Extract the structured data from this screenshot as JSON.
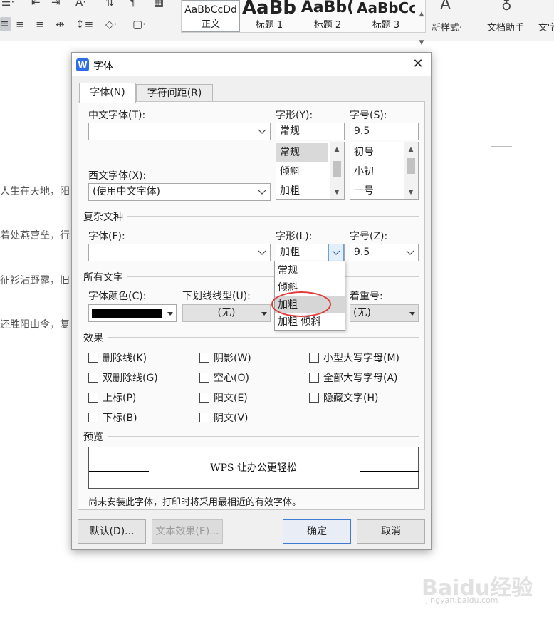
{
  "ribbon": {
    "styles": [
      {
        "preview": "AaBbCcDd",
        "name": "正文"
      },
      {
        "preview": "AaBb",
        "name": "标题 1"
      },
      {
        "preview": "AaBb(",
        "name": "标题 2"
      },
      {
        "preview": "AaBbCc",
        "name": "标题 3"
      }
    ],
    "new_style": "新样式·",
    "doc_assistant": "文档助手",
    "text_tools": "文字"
  },
  "document": {
    "lines": [
      "人生在天地，阳",
      "着处燕营垒，行",
      "征衫沾野露，旧",
      "还胜阳山令，复"
    ]
  },
  "dialog": {
    "app_icon": "W",
    "title": "字体",
    "close": "✕",
    "tabs": [
      "字体(N)",
      "字符间距(R)"
    ],
    "chinese_font_label": "中文字体(T):",
    "chinese_font_value": "",
    "style_label": "字形(Y):",
    "style_value": "常规",
    "style_list": [
      "常规",
      "倾斜",
      "加粗"
    ],
    "size_label": "字号(S):",
    "size_value": "9.5",
    "size_list": [
      "初号",
      "小初",
      "一号"
    ],
    "western_font_label": "西文字体(X):",
    "western_font_value": "(使用中文字体)",
    "complex_section": "复杂文种",
    "complex_font_label": "字体(F):",
    "complex_font_value": "",
    "complex_style_label": "字形(L):",
    "complex_style_value": "加粗",
    "complex_size_label": "字号(Z):",
    "complex_size_value": "9.5",
    "all_text_section": "所有文字",
    "font_color_label": "字体颜色(C):",
    "font_color_value": "#000000",
    "underline_label": "下划线线型(U):",
    "underline_value": "(无)",
    "emphasis_label": "着重号:",
    "emphasis_value": "(无)",
    "effects_section": "效果",
    "effects": [
      [
        "删除线(K)",
        "阴影(W)",
        "小型大写字母(M)"
      ],
      [
        "双删除线(G)",
        "空心(O)",
        "全部大写字母(A)"
      ],
      [
        "上标(P)",
        "阳文(E)",
        "隐藏文字(H)"
      ],
      [
        "下标(B)",
        "阴文(V)"
      ]
    ],
    "preview_section": "预览",
    "preview_text": "WPS 让办公更轻松",
    "note": "尚未安装此字体，打印时将采用最相近的有效字体。",
    "buttons": {
      "default": "默认(D)...",
      "text_effects": "文本效果(E)...",
      "ok": "确定",
      "cancel": "取消"
    },
    "dropdown_options": [
      "常规",
      "倾斜",
      "加粗",
      "加粗 倾斜"
    ],
    "dropdown_highlighted": "加粗"
  },
  "watermark": {
    "main": "Baidu经验",
    "sub": "jingyan.baidu.com"
  }
}
